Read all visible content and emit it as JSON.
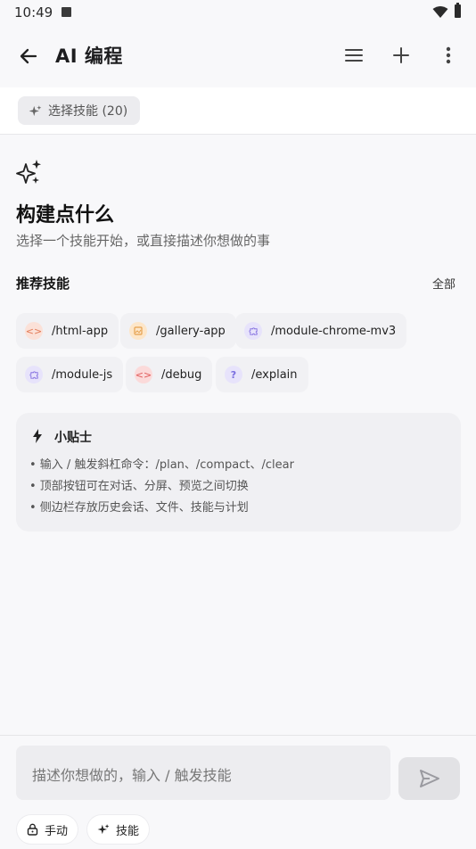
{
  "status": {
    "time": "10:49"
  },
  "appbar": {
    "title": "AI 编程"
  },
  "skillbar": {
    "select_label": "选择技能 (20)"
  },
  "hero": {
    "heading": "构建点什么",
    "subheading": "选择一个技能开始，或直接描述你想做的事"
  },
  "recommended": {
    "title": "推荐技能",
    "all_label": "全部",
    "skills": [
      {
        "label": "/html-app",
        "icon": "code-icon"
      },
      {
        "label": "/gallery-app",
        "icon": "image-icon"
      },
      {
        "label": "/module-chrome-mv3",
        "icon": "puzzle-icon"
      },
      {
        "label": "/module-js",
        "icon": "puzzle-icon"
      },
      {
        "label": "/debug",
        "icon": "code-icon"
      },
      {
        "label": "/explain",
        "icon": "help-icon"
      }
    ]
  },
  "tips": {
    "title": "小贴士",
    "items": [
      "• 输入 / 触发斜杠命令：/plan、/compact、/clear",
      "• 顶部按钮可在对话、分屏、预览之间切换",
      "• 侧边栏存放历史会话、文件、技能与计划"
    ]
  },
  "composer": {
    "placeholder": "描述你想做的，输入 / 触发技能",
    "mode_label": "手动",
    "skills_label": "技能"
  },
  "colors": {
    "accent_orange": "#e27a57",
    "accent_purple": "#8572e0",
    "background": "#f8f8fa"
  }
}
